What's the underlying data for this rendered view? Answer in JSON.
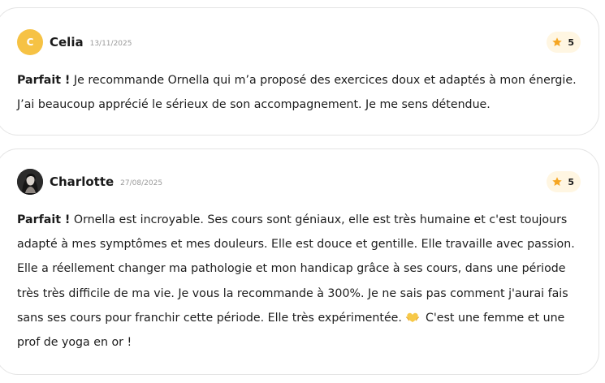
{
  "reviews": [
    {
      "avatar_letter": "C",
      "name": "Celia",
      "date": "13/11/2025",
      "rating": "5",
      "lead": "Parfait !",
      "text": "Je recommande Ornella qui m’a proposé des exercices doux et adaptés à mon énergie. J’ai beaucoup apprécié le sérieux de son accompagnement. Je me sens détendue."
    },
    {
      "name": "Charlotte",
      "date": "27/08/2025",
      "rating": "5",
      "lead": "Parfait !",
      "text_before_icon": "Ornella est incroyable. Ses cours sont géniaux, elle est très humaine et c'est toujours adapté à mes symptômes et mes douleurs. Elle est douce et gentille. Elle travaille avec passion. Elle a réellement changer ma pathologie et mon handicap grâce à ses cours, dans une période très très difficile de ma vie. Je vous la recommande à 300%. Je ne sais pas comment j'aurai fais sans ses cours pour franchir cette période. Elle très expérimentée.",
      "text_after_icon": "C'est une femme et une prof de yoga en or !",
      "inline_icon": "heart-hands-icon"
    }
  ],
  "colors": {
    "avatar_bg": "#f6c244",
    "star": "#f5a623",
    "rating_bg": "#fff6e2",
    "border": "#e4e4e4"
  }
}
